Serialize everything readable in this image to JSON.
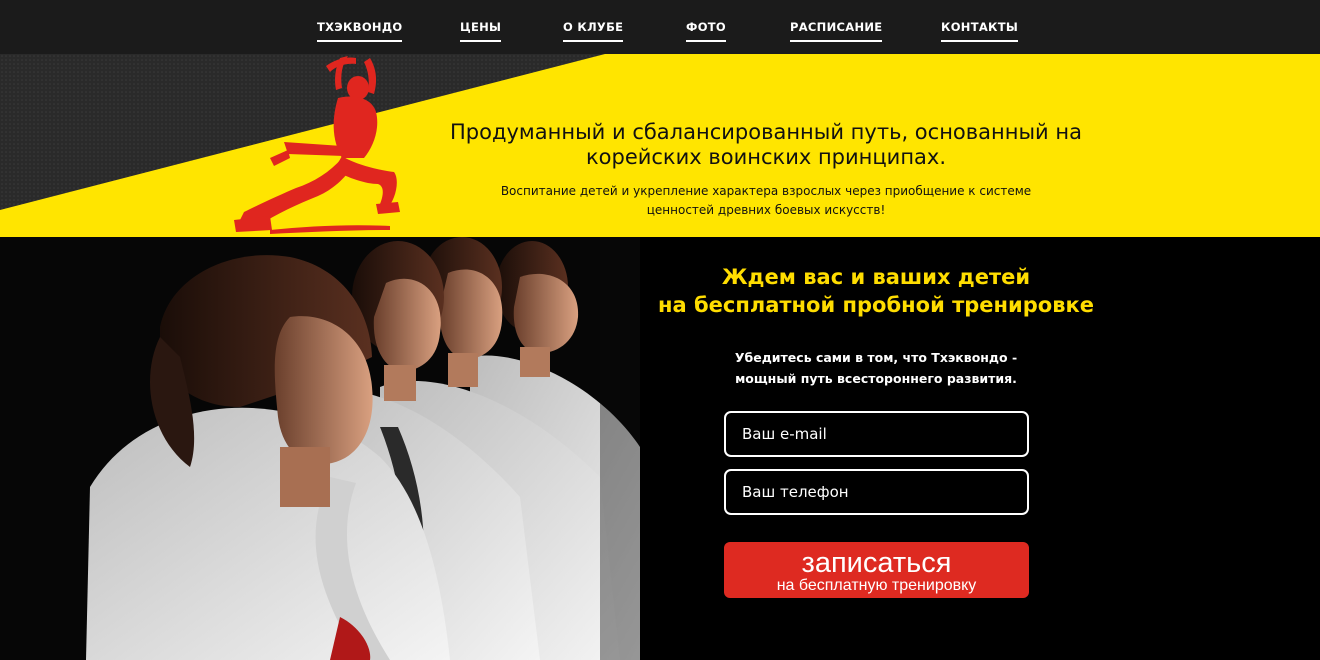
{
  "nav": {
    "items": [
      "ТХЭКВОНДО",
      "ЦЕНЫ",
      "О КЛУБЕ",
      "ФОТО",
      "РАСПИСАНИЕ",
      "КОНТАКТЫ"
    ]
  },
  "hero": {
    "title_line1": "Продуманный и сбалансированный путь, основанный на",
    "title_line2": "корейских воинских принципах.",
    "subtitle_line1": "Воспитание детей и укрепление характера взрослых через приобщение к системе",
    "subtitle_line2": "ценностей древних боевых искусств!"
  },
  "cta": {
    "title_line1": "Ждем вас и ваших детей",
    "title_line2": "на бесплатной пробной тренировке",
    "text_line1": "Убедитесь сами в том, что Тхэквондо -",
    "text_line2": "мощный путь всестороннего развития.",
    "email_placeholder": "Ваш e-mail",
    "phone_placeholder": "Ваш телефон",
    "button_main": "записаться",
    "button_sub": "на бесплатную тренировку"
  },
  "colors": {
    "accent_yellow": "#ffe500",
    "accent_red": "#de2a21",
    "nav_bg": "#1b1b1b"
  }
}
